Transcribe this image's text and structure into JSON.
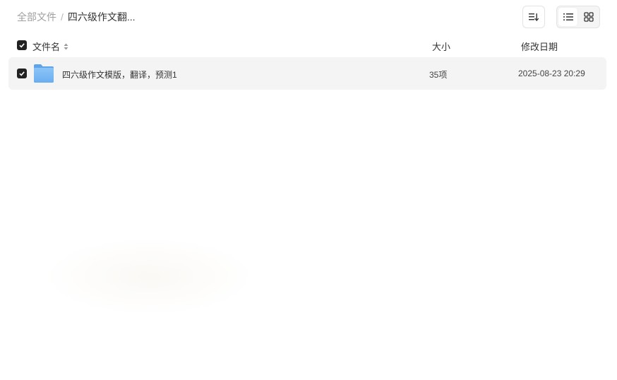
{
  "breadcrumb": {
    "root": "全部文件",
    "separator": "/",
    "current": "四六级作文翻..."
  },
  "toolbar": {
    "sort_icon": "sort-icon",
    "list_view_icon": "list-view-icon",
    "grid_view_icon": "grid-view-icon",
    "active_view": "list"
  },
  "table": {
    "header": {
      "name": "文件名",
      "size": "大小",
      "date": "修改日期"
    },
    "rows": [
      {
        "icon": "folder-icon",
        "name": "四六级作文模版，翻译，预测1",
        "size": "35项",
        "date": "2025-08-23 20:29",
        "checked": true
      }
    ]
  },
  "colors": {
    "folder": "#7cb7f3",
    "row_bg": "#f4f4f4",
    "checkbox": "#222222"
  }
}
